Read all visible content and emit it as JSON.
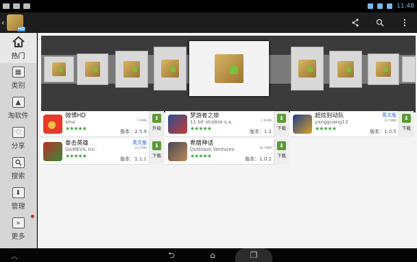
{
  "status_bar": {
    "time": "11:48"
  },
  "action_bar": {
    "logo_badge": "HD",
    "buttons": [
      "share-icon",
      "search-icon",
      "overflow-icon"
    ]
  },
  "sidebar": {
    "items": [
      {
        "label": "热门",
        "icon": "home-icon",
        "active": true
      },
      {
        "label": "类别",
        "icon": "category-icon",
        "active": false
      },
      {
        "label": "淘软件",
        "icon": "image-icon",
        "active": false
      },
      {
        "label": "分享",
        "icon": "heart-icon",
        "active": false
      },
      {
        "label": "搜索",
        "icon": "search-icon",
        "active": false
      },
      {
        "label": "管理",
        "icon": "download-icon",
        "active": false
      },
      {
        "label": "更多",
        "icon": "more-icon",
        "active": false
      }
    ]
  },
  "apps": [
    {
      "name": "微博HD",
      "developer": "sina",
      "size": "7.36MB",
      "version": "版本：2.5.9",
      "action": "升级",
      "badge": ""
    },
    {
      "name": "梦游者之旅",
      "developer": "11 bit studios s.a.",
      "size": "2.91MB",
      "version": "版本：1.2",
      "action": "下载",
      "badge": ""
    },
    {
      "name": "超炫别动队",
      "developer": "yangguang13",
      "size": "23.78MB",
      "version": "版本：1.0.5",
      "action": "下载",
      "badge": "英文版"
    },
    {
      "name": "拳击英雄",
      "developer": "GAMEVIL Inc.",
      "size": "23.27MB",
      "version": "版本：1.1.1",
      "action": "下载",
      "badge": "英文版"
    },
    {
      "name": "希腊神话",
      "developer": "Outblaze Ventures",
      "size": "46.78MB",
      "version": "版本：1.0.2",
      "action": "下载",
      "badge": ""
    }
  ],
  "stars": "★★★★★",
  "colors": {
    "accent_green": "#5b9b32",
    "badge_blue": "#2d63c7",
    "status_blue": "#7ab7e5"
  }
}
